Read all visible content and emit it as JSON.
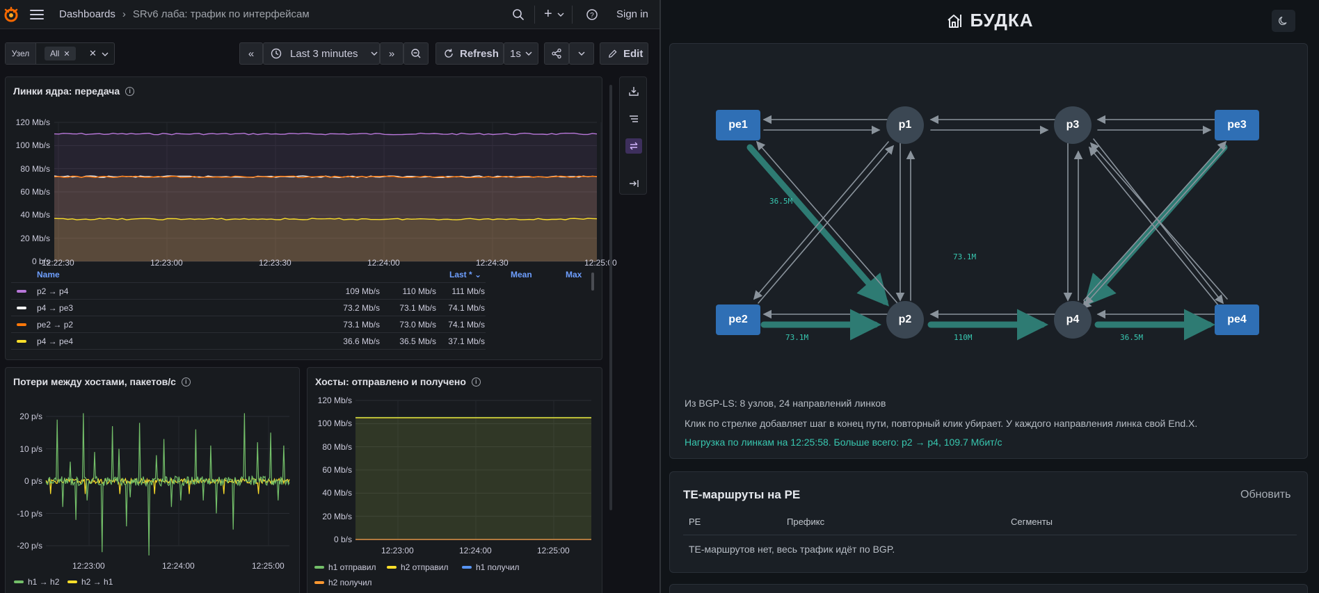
{
  "grafana": {
    "breadcrumb": {
      "home": "Dashboards",
      "separator": "›",
      "dashboard": "SRv6 лаба: трафик по интерфейсам"
    },
    "topbar": {
      "sign_in": "Sign in",
      "search_icon": "search-icon",
      "plus": "+",
      "help_icon": "help-icon"
    },
    "toolbar": {
      "var_label": "Узел",
      "var_value": "All",
      "time_range": "Last 3 minutes",
      "refresh_label": "Refresh",
      "refresh_interval": "1s",
      "edit_label": "Edit"
    },
    "panel1": {
      "title": "Линки ядра: передача",
      "chart_data": {
        "type": "line",
        "title": "Линки ядра: передача",
        "x": [
          "12:22:30",
          "12:23:00",
          "12:23:30",
          "12:24:00",
          "12:24:30",
          "12:25:00"
        ],
        "yticks": [
          "120 Mb/s",
          "100 Mb/s",
          "80 Mb/s",
          "60 Mb/s",
          "40 Mb/s",
          "20 Mb/s",
          "0 b/s"
        ],
        "ylim": [
          0,
          120
        ],
        "series": [
          {
            "name": "p2 → p4",
            "level": 110,
            "color": "#b877d9"
          },
          {
            "name": "p4 → pe3",
            "level": 73.1,
            "color": "#f2f2f2"
          },
          {
            "name": "pe2 → p2",
            "level": 73.0,
            "color": "#ff780a"
          },
          {
            "name": "p4 → pe4",
            "level": 36.5,
            "color": "#fade2a"
          }
        ]
      },
      "legend": {
        "headers": {
          "name": "Name",
          "last": "Last *",
          "mean": "Mean",
          "max": "Max"
        },
        "rows": [
          {
            "name": "p2 → p4",
            "last": "109 Mb/s",
            "mean": "110 Mb/s",
            "max": "111 Mb/s",
            "color": "#b877d9"
          },
          {
            "name": "p4 → pe3",
            "last": "73.2 Mb/s",
            "mean": "73.1 Mb/s",
            "max": "74.1 Mb/s",
            "color": "#f2f2f2"
          },
          {
            "name": "pe2 → p2",
            "last": "73.1 Mb/s",
            "mean": "73.0 Mb/s",
            "max": "74.1 Mb/s",
            "color": "#ff780a"
          },
          {
            "name": "p4 → pe4",
            "last": "36.6 Mb/s",
            "mean": "36.5 Mb/s",
            "max": "37.1 Mb/s",
            "color": "#fade2a"
          }
        ]
      }
    },
    "panel2": {
      "title": "Потери между хостами, пакетов/с",
      "chart_data": {
        "type": "line",
        "title": "Потери между хостами, пакетов/с",
        "x": [
          "12:23:00",
          "12:24:00",
          "12:25:00"
        ],
        "yticks": [
          "20 p/s",
          "10 p/s",
          "0 p/s",
          "-10 p/s",
          "-20 p/s"
        ],
        "ylim": [
          -20,
          20
        ],
        "series": [
          {
            "name": "h1 → h2",
            "color": "#73bf69"
          },
          {
            "name": "h2 → h1",
            "color": "#fade2a"
          }
        ]
      }
    },
    "panel3": {
      "title": "Хосты: отправлено и получено",
      "chart_data": {
        "type": "area",
        "title": "Хосты: отправлено и получено",
        "x": [
          "12:23:00",
          "12:24:00",
          "12:25:00"
        ],
        "yticks": [
          "120 Mb/s",
          "100 Mb/s",
          "80 Mb/s",
          "60 Mb/s",
          "40 Mb/s",
          "20 Mb/s",
          "0 b/s"
        ],
        "ylim": [
          0,
          120
        ],
        "series": [
          {
            "name": "h1 отправил",
            "level": 105,
            "color": "#73bf69"
          },
          {
            "name": "h2 отправил",
            "level": 105,
            "color": "#fade2a"
          },
          {
            "name": "h1 получил",
            "level": 0,
            "color": "#5794f2"
          },
          {
            "name": "h2 получил",
            "level": 0,
            "color": "#ff9830"
          }
        ]
      }
    }
  },
  "budka": {
    "title": "БУДКА",
    "title_icon": "house-icon",
    "theme_icon": "moon-icon",
    "topology": {
      "nodes": [
        "pe1",
        "p1",
        "p3",
        "pe3",
        "pe2",
        "p2",
        "p4",
        "pe4"
      ],
      "edge_labels": [
        "36.5M",
        "73.1M",
        "73.1M",
        "110M",
        "36.5M"
      ]
    },
    "info_lines": [
      "Из BGP-LS: 8 узлов, 24 направлений линков",
      "Клик по стрелке добавляет шаг в конец пути, повторный клик убирает. У каждого направления линка свой End.X."
    ],
    "load_line": "Нагрузка по линкам на 12:25:58. Больше всего: p2 → p4, 109.7 Мбит/с",
    "te": {
      "title": "TE-маршруты на PE",
      "refresh": "Обновить",
      "headers": [
        "PE",
        "Префикс",
        "Сегменты"
      ],
      "empty": "TE-маршрутов нет, весь трафик идёт по BGP."
    },
    "colors": {
      "accent": "#38c7b0",
      "node_pe": "#2f6fb5",
      "node_p": "#3b4753"
    }
  }
}
